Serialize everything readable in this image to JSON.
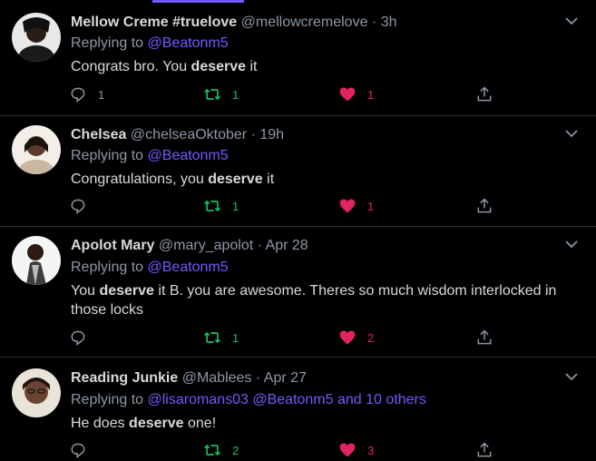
{
  "colors": {
    "accent": "#7856ff",
    "retweet": "#17bf63",
    "like": "#e0245e",
    "muted": "#8b98a5",
    "text": "#d9d9d9"
  },
  "tweets": [
    {
      "name": "Mellow Creme #truelove",
      "handle": "@mellowcremelove",
      "time": "3h",
      "replying_prefix": "Replying to ",
      "replying_links": "@Beatonm5",
      "text_before": "Congrats bro. You ",
      "text_bold": "deserve",
      "text_after": " it",
      "replies": "1",
      "retweets": "1",
      "likes": "1"
    },
    {
      "name": "Chelsea",
      "handle": "@chelseaOktober",
      "time": "19h",
      "replying_prefix": "Replying to ",
      "replying_links": "@Beatonm5",
      "text_before": "Congratulations, you ",
      "text_bold": "deserve",
      "text_after": " it",
      "replies": "",
      "retweets": "1",
      "likes": "1"
    },
    {
      "name": "Apolot Mary",
      "handle": "@mary_apolot",
      "time": "Apr 28",
      "replying_prefix": "Replying to ",
      "replying_links": "@Beatonm5",
      "text_before": "You ",
      "text_bold": "deserve",
      "text_after": " it B. you are awesome. Theres so  much wisdom interlocked in those locks",
      "replies": "",
      "retweets": "1",
      "likes": "2"
    },
    {
      "name": "Reading Junkie",
      "handle": "@Mablees",
      "time": "Apr 27",
      "replying_prefix": "Replying to ",
      "replying_links": "@lisaromans03 @Beatonm5 and 10 others",
      "text_before": "He does ",
      "text_bold": "deserve",
      "text_after": " one!",
      "replies": "",
      "retweets": "2",
      "likes": "3"
    }
  ],
  "separator": " · "
}
